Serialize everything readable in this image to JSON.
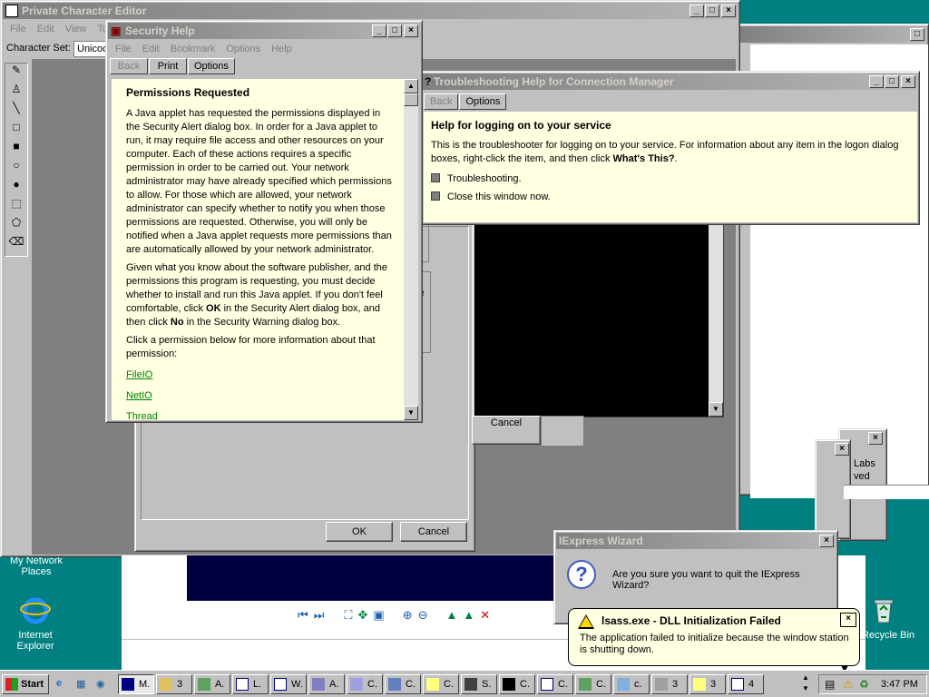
{
  "pce": {
    "title": "Private Character Editor",
    "menu": [
      "File",
      "Edit",
      "View",
      "To"
    ],
    "charset_label": "Character Set:",
    "charset_value": "Unicod"
  },
  "help": {
    "title": "Security Help",
    "menu": [
      "File",
      "Edit",
      "Bookmark",
      "Options",
      "Help"
    ],
    "buttons": {
      "back": "Back",
      "print": "Print",
      "options": "Options"
    },
    "heading": "Permissions Requested",
    "p1": "A Java applet has requested the permissions displayed in the Security Alert dialog box. In order for a Java applet to run, it may require file access and other resources on your computer. Each of these actions requires a specific permission in order to be carried out. Your network administrator may have already specified which permissions to allow. For those which are allowed, your network administrator can specify whether to notify you when those permissions are requested. Otherwise, you will only be notified when a Java applet requests more permissions than are automatically allowed by your network administrator.",
    "p2a": "Given what you know about the software publisher, and the permissions this program is requesting, you must decide whether to install and run this Java applet. If you don't feel comfortable, click ",
    "p2ok": "OK",
    "p2b": " in the Security Alert dialog box, and then click ",
    "p2no": "No",
    "p2c": " in the Security Warning dialog box.",
    "p3": "Click a permission below for more information about that permission:",
    "links": [
      "FileIO",
      "NetIO",
      "Thread"
    ]
  },
  "trouble": {
    "title": "Troubleshooting Help for Connection Manager",
    "buttons": {
      "back": "Back",
      "options": "Options"
    },
    "heading": "Help for logging on to your service",
    "text_a": "This is the troubleshooter for logging on to your service. For information about any item in the logon dialog boxes, right-click the item, and then click ",
    "text_bold": "What's This?",
    "text_b": ".",
    "items": [
      "Troubleshooting.",
      "Close this window now."
    ]
  },
  "dialog_bg": {
    "ok": "OK",
    "cancel": "Cancel",
    "cancel2": "Cancel",
    "frag": "le"
  },
  "small_win": {
    "line1": "Labs",
    "line2": "ved"
  },
  "iexpress": {
    "title": "IExpress Wizard",
    "question": "Are you sure you want to quit the IExpress Wizard?"
  },
  "balloon": {
    "title": "lsass.exe - DLL Initialization Failed",
    "text": "The application failed to initialize because the window station is shutting down."
  },
  "desktop": {
    "network": "My Network Places",
    "ie": "Internet Explorer",
    "recycle": "Recycle Bin"
  },
  "taskbar": {
    "start": "Start",
    "clock": "3:47 PM",
    "items": [
      "M.",
      "3",
      "A.",
      "L.",
      "W.",
      "A.",
      "C.",
      "C.",
      "C.",
      "S.",
      "C.",
      "C.",
      "C.",
      "c.",
      "3",
      "3",
      "4"
    ]
  }
}
